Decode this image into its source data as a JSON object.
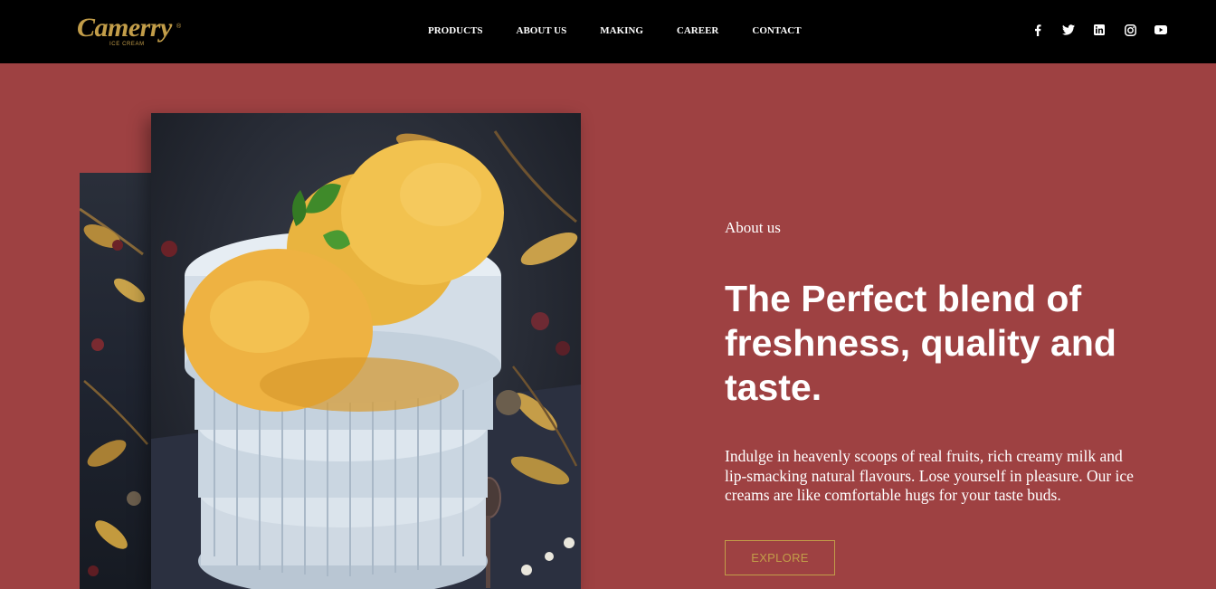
{
  "brand": {
    "name": "Camerry",
    "registered": "®",
    "tagline": "ICE CREAM",
    "color": "#c29d49"
  },
  "nav": {
    "items": [
      {
        "label": "PRODUCTS"
      },
      {
        "label": "ABOUT US"
      },
      {
        "label": "MAKING"
      },
      {
        "label": "CAREER"
      },
      {
        "label": "CONTACT"
      }
    ]
  },
  "social": {
    "icons": [
      "facebook-icon",
      "twitter-icon",
      "linkedin-icon",
      "instagram-icon",
      "youtube-icon"
    ]
  },
  "hero": {
    "eyebrow": "About us",
    "headline": "The Perfect blend of freshness, quality and taste.",
    "body": "Indulge in heavenly scoops of real fruits, rich creamy milk and lip-smacking natural flavours. Lose yourself in pleasure. Our ice creams are like comfortable hugs for your taste buds.",
    "cta_label": "EXPLORE"
  },
  "colors": {
    "background": "#9e4142",
    "header": "#000000",
    "accent": "#c29d49",
    "text": "#ffffff"
  }
}
